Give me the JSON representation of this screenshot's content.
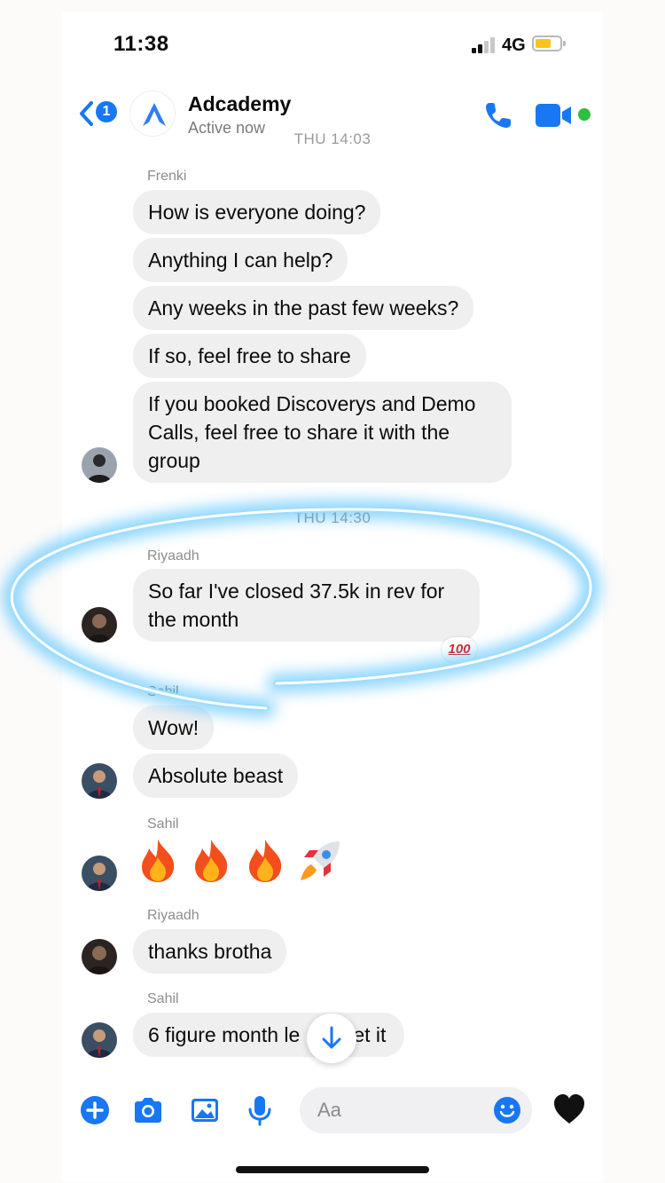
{
  "status_bar": {
    "time": "11:38",
    "network": "4G"
  },
  "header": {
    "back_count": "1",
    "title": "Adcademy",
    "subtitle": "Active now"
  },
  "timestamps": [
    "THU 14:03",
    "THU 14:30"
  ],
  "messages": {
    "frenki_sender": "Frenki",
    "frenki": [
      "How is everyone doing?",
      "Anything I can help?",
      "Any weeks in the past few weeks?",
      "If so, feel free to share",
      "If you booked Discoverys and Demo Calls, feel free to share it with the group"
    ],
    "riyaadh_sender": "Riyaadh",
    "riyaadh_1": "So far I've closed 37.5k in rev for the month",
    "reaction": "100",
    "sahil_sender": "Sahil",
    "sahil_1": "Wow!",
    "sahil_2": "Absolute beast",
    "sahil_sender_2": "Sahil",
    "sahil_emojis": [
      "fire-emoji",
      "fire-emoji",
      "fire-emoji",
      "rocket-emoji"
    ],
    "riyaadh_sender_2": "Riyaadh",
    "riyaadh_2": "thanks brotha",
    "sahil_sender_3": "Sahil",
    "sahil_3": "6 figure month le",
    "sahil_3_tail": "et it"
  },
  "composer": {
    "placeholder": "Aa"
  },
  "colors": {
    "accent": "#1877f2",
    "bubble": "#efeff0",
    "online": "#2fbf40",
    "glow": "#36b6ff"
  }
}
